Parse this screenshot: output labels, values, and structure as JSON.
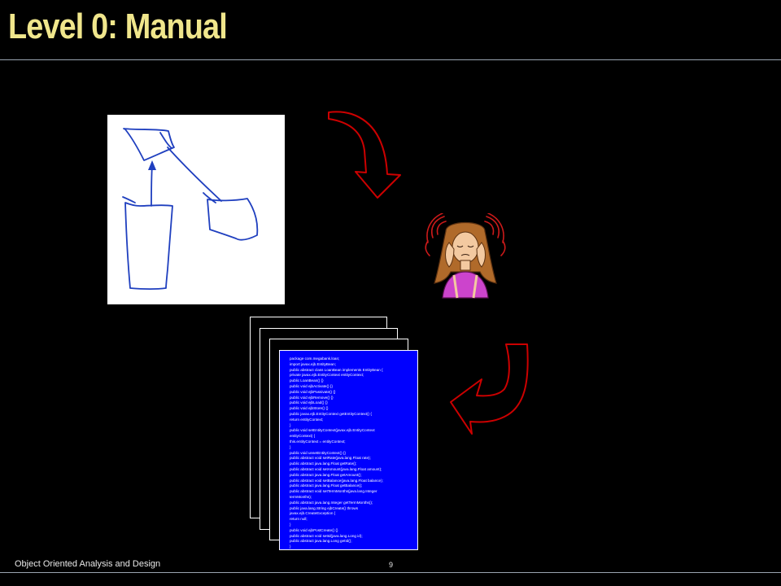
{
  "slide": {
    "title": "Level 0: Manual",
    "footer_text": "Object Oriented Analysis and Design",
    "page_number": "9"
  },
  "colors": {
    "background": "#000000",
    "title": "#f0e68c",
    "rule": "#9aa4b0",
    "arrow": "#cc0000",
    "sketch_ink": "#1f3fbf",
    "code_page": "#0000ff"
  },
  "icons": {
    "sketch": "hand-drawn-class-diagram",
    "arrow_1": "curved-arrow-down-right",
    "arrow_2": "curved-arrow-down-left",
    "person": "stressed-woman-clipart"
  },
  "code_lines": [
    "package com.megabank.loan;",
    "import javax.ejb.EntityBean;",
    "public abstract class LoanBean implements EntityBean {",
    "  private javax.ejb.EntityContext entityContext;",
    "  public LoanBean() {}",
    "  public void ejbActivate() {}",
    "  public void ejbPassivate() {}",
    "  public void ejbRemove() {}",
    "  public void ejbLoad() {}",
    "  public void ejbStore() {}",
    "  public javax.ejb.EntityContext getEntityContext() {",
    "    return entityContext;",
    "  }",
    "  public void setEntityContext(javax.ejb.EntityContext",
    "entityContext) {",
    "    this.entityContext = entityContext;",
    "  }",
    "  public void unsetEntityContext() {}",
    "  public abstract void setRate(java.lang.Float rate);",
    "  public abstract java.lang.Float getRate();",
    "  public abstract void setAmount(java.lang.Float amount);",
    "  public abstract java.lang.Float getAmount();",
    "  public abstract void setBalance(java.lang.Float balance);",
    "  public abstract java.lang.Float getBalance();",
    "  public abstract void setTermMonths(java.lang.Integer",
    "termMonths);",
    "  public abstract java.lang.Integer getTermMonths();",
    "  public java.lang.String ejbCreate() throws",
    "javax.ejb.CreateException {",
    "    return null;",
    "  }",
    "  public void ejbPostCreate() {}",
    "  public abstract void setId(java.lang.Long id);",
    "  public abstract java.lang.Long getId();",
    "}",
    "}"
  ]
}
